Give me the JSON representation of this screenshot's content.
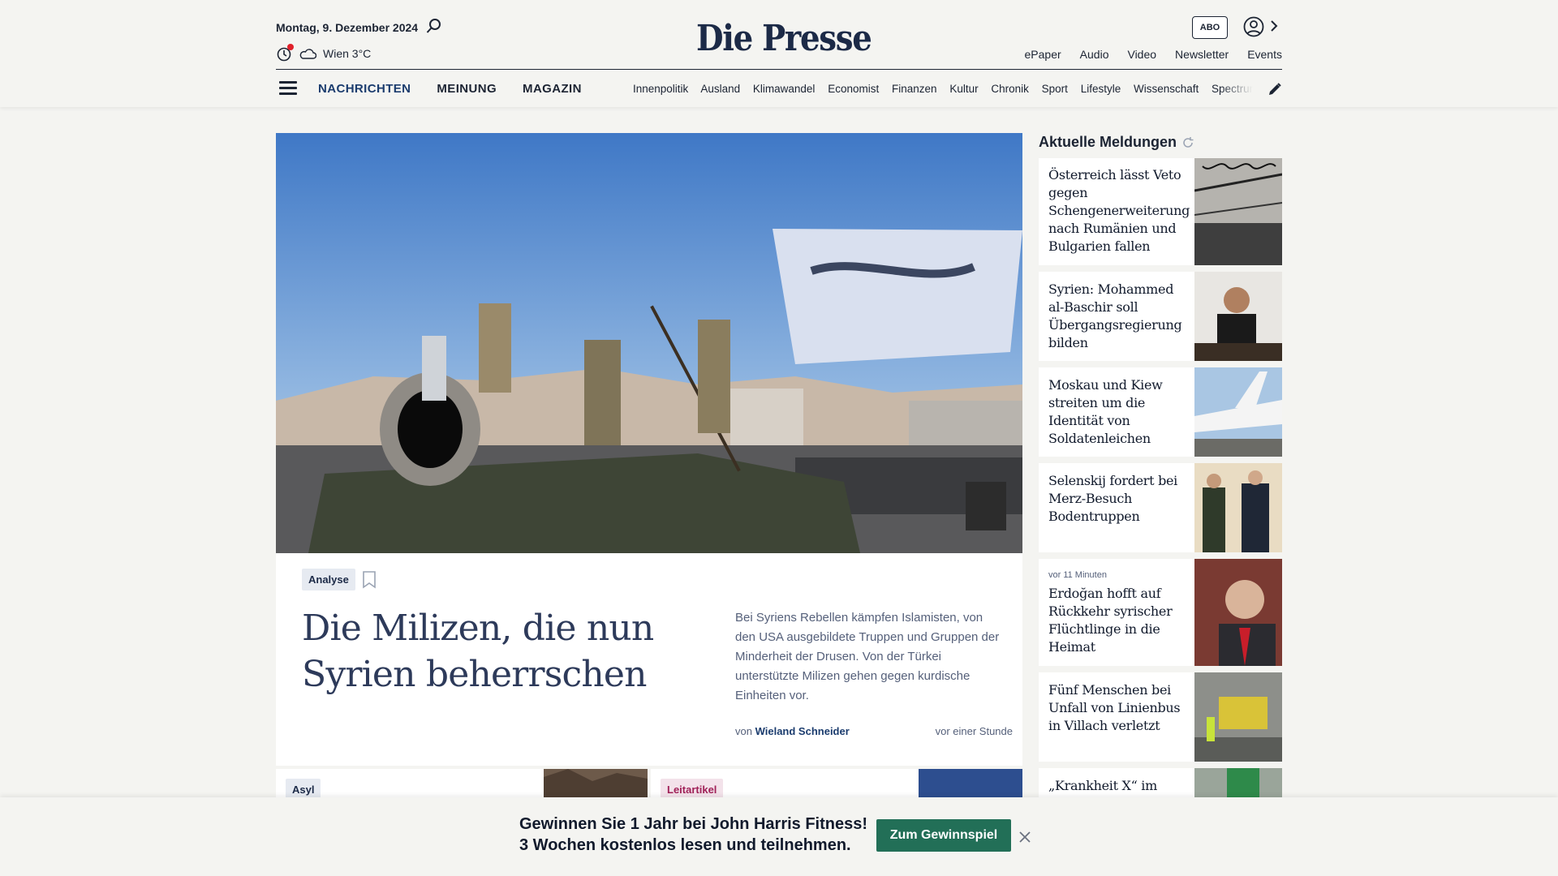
{
  "header": {
    "date": "Montag, 9. Dezember 2024",
    "weather": "Wien 3°C",
    "logo": "Die Presse",
    "abo_label": "ABO",
    "utility_nav": [
      "ePaper",
      "Audio",
      "Video",
      "Newsletter",
      "Events"
    ],
    "main_nav": [
      "NACHRICHTEN",
      "MEINUNG",
      "MAGAZIN"
    ],
    "sub_nav": [
      "Innenpolitik",
      "Ausland",
      "Klimawandel",
      "Economist",
      "Finanzen",
      "Kultur",
      "Chronik",
      "Sport",
      "Lifestyle",
      "Wissenschaft",
      "Spectrum"
    ]
  },
  "hero": {
    "tag": "Analyse",
    "title": "Die Milizen, die nun Syrien beherrschen",
    "teaser": "Bei Syriens Rebellen kämpfen Islamisten, von den USA ausgebildete Truppen und Gruppen der Minderheit der Drusen. Von der Türkei unterstützte Milizen gehen gegen kurdische Einheiten vor.",
    "byline_prefix": "von",
    "author": "Wieland Schneider",
    "time": "vor einer Stunde"
  },
  "teasers": [
    {
      "tag": "Asyl"
    },
    {
      "tag": "Leitartikel"
    }
  ],
  "sidebar": {
    "title": "Aktuelle Meldungen",
    "items": [
      {
        "headline": "Österreich lässt Veto gegen Schengenerweiterung nach Rumänien und Bulgarien fallen"
      },
      {
        "headline": "Syrien: Mohammed al-Baschir soll Übergangsregierung bilden"
      },
      {
        "headline": "Moskau und Kiew streiten um die Identität von Soldatenleichen"
      },
      {
        "headline": "Selenskij fordert bei Merz-Besuch Bodentruppen"
      },
      {
        "time": "vor 11 Minuten",
        "headline": "Erdoğan hofft auf Rückkehr syrischer Flüchtlinge in die Heimat"
      },
      {
        "headline": "Fünf Menschen bei Unfall von Linienbus in Villach verletzt"
      },
      {
        "headline": "„Krankheit X“ im"
      }
    ]
  },
  "promo": {
    "line1": "Gewinnen Sie 1 Jahr bei John Harris Fitness!",
    "line2": "3 Wochen kostenlos lesen und teilnehmen.",
    "button": "Zum Gewinnspiel"
  },
  "colors": {
    "brand_navy": "#1c2a47",
    "nav_active": "#1b3c6e",
    "promo_button": "#226f57",
    "alert_dot": "#e0202a",
    "leitartikel": "#a02158"
  }
}
